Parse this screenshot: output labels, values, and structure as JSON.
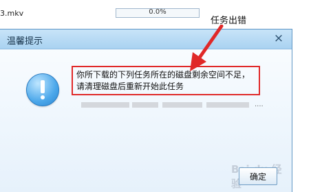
{
  "background": {
    "filename": "3.mkv",
    "progress_text": "0.0%",
    "progress_value": 0.0
  },
  "annotation": {
    "label": "任务出错"
  },
  "dialog": {
    "title": "温馨提示",
    "close_icon": "×",
    "message": "你所下载的下列任务所在的磁盘剩余空间不足，请清理磁盘后重新开始此任务",
    "path_ellipsis": "....",
    "ok_label": "确定"
  },
  "icons": {
    "info": "info-icon",
    "close": "close-icon",
    "arrow": "red-arrow-icon"
  },
  "colors": {
    "highlight_border": "#e02828",
    "arrow": "#e02828",
    "titlebar": "#b7dbf5",
    "icon_blue": "#3f9ee6"
  },
  "watermark": {
    "text": "Bai du 经验"
  }
}
